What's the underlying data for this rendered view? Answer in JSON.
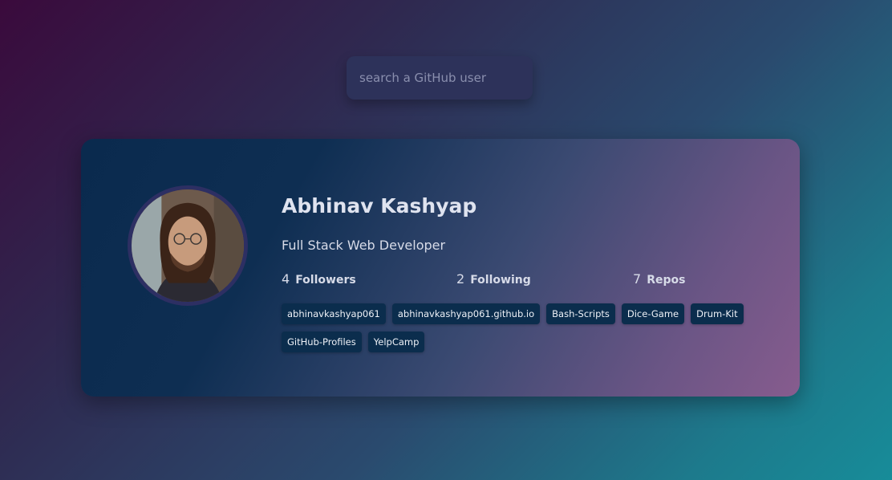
{
  "search": {
    "placeholder": "search a GitHub user",
    "value": ""
  },
  "profile": {
    "name": "Abhinav Kashyap",
    "bio": "Full Stack Web Developer",
    "avatar_alt": "avatar",
    "stats": {
      "followers": {
        "count": "4",
        "label": "Followers"
      },
      "following": {
        "count": "2",
        "label": "Following"
      },
      "repos": {
        "count": "7",
        "label": "Repos"
      }
    },
    "repos": [
      "abhinavkashyap061",
      "abhinavkashyap061.github.io",
      "Bash-Scripts",
      "Dice-Game",
      "Drum-Kit",
      "GitHub-Profiles",
      "YelpCamp"
    ]
  },
  "colors": {
    "card_start": "#0a2a4e",
    "card_end": "#875c8e",
    "repo_chip": "#0b2d4d",
    "search_bg": "#2d325a"
  }
}
